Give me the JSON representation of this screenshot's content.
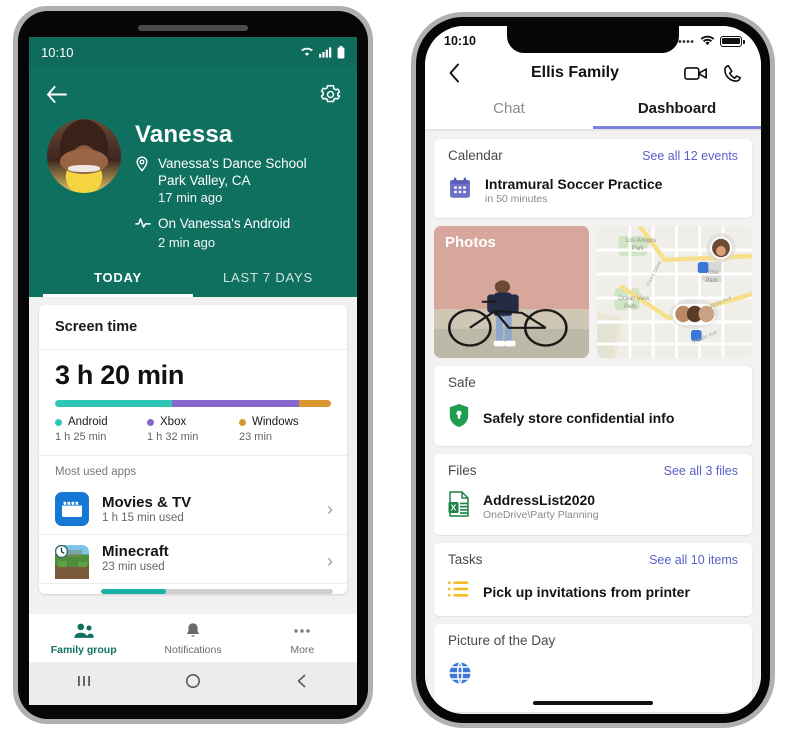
{
  "android": {
    "status": {
      "time": "10:10",
      "wifi_icon": "wifi-icon",
      "signal_icon": "cellular-signal-icon",
      "battery_icon": "battery-icon"
    },
    "header": {
      "back_icon": "back-arrow-icon",
      "settings_icon": "gear-icon",
      "profile_name": "Vanessa",
      "avatar": "avatar",
      "location_icon": "location-pin-icon",
      "location_line1": "Vanessa's Dance School",
      "location_line2": "Park Valley, CA",
      "location_time": "17 min ago",
      "activity_icon": "activity-pulse-icon",
      "activity_text": "On Vanessa's Android",
      "activity_time": "2 min ago",
      "tabs": [
        {
          "label": "TODAY",
          "active": true
        },
        {
          "label": "LAST 7 DAYS",
          "active": false
        }
      ]
    },
    "screen_time": {
      "card_title": "Screen time",
      "total": "3 h 20 min",
      "most_used_label": "Most used apps",
      "apps": [
        {
          "name": "Movies & TV",
          "usage": "1 h 15 min used",
          "icon": "movies-and-tv-icon",
          "chevron": "chevron-right-icon"
        },
        {
          "name": "Minecraft",
          "usage": "23 min used",
          "icon": "minecraft-icon",
          "chevron": "chevron-right-icon",
          "progress_pct": 28
        }
      ]
    },
    "bottom_nav": [
      {
        "label": "Family group",
        "icon": "family-group-icon",
        "active": true
      },
      {
        "label": "Notifications",
        "icon": "bell-icon",
        "active": false
      },
      {
        "label": "More",
        "icon": "more-dots-icon",
        "active": false
      }
    ],
    "system_nav": [
      {
        "icon": "recents-icon",
        "glyph": "|||"
      },
      {
        "icon": "home-icon",
        "glyph": "○"
      },
      {
        "icon": "back-icon",
        "glyph": "‹"
      }
    ]
  },
  "chart_data": {
    "type": "bar",
    "title": "Screen time",
    "orientation": "horizontal-stacked",
    "total_label": "3 h 20 min",
    "total_minutes": 200,
    "categories": [
      "Android",
      "Xbox",
      "Windows"
    ],
    "values": [
      85,
      92,
      23
    ],
    "value_labels": [
      "1 h 25 min",
      "1 h 32 min",
      "23 min"
    ],
    "colors": [
      "#2ec6b6",
      "#8766cd",
      "#d9982f"
    ],
    "percentages": [
      42.5,
      46.0,
      11.5
    ],
    "ylabel": "",
    "xlabel": "",
    "legend": "bottom",
    "grid": false
  },
  "ios": {
    "status": {
      "time": "10:10",
      "dots_icon": "signal-dots-icon",
      "wifi_icon": "wifi-icon",
      "battery_icon": "battery-icon"
    },
    "titlebar": {
      "back_icon": "chevron-left-icon",
      "title": "Ellis Family",
      "video_icon": "video-camera-icon",
      "call_icon": "phone-icon"
    },
    "tabs": [
      {
        "label": "Chat",
        "active": false
      },
      {
        "label": "Dashboard",
        "active": true
      }
    ],
    "cards": {
      "calendar": {
        "title": "Calendar",
        "link": "See all 12 events",
        "icon": "calendar-icon",
        "item_title": "Intramural Soccer Practice",
        "item_sub": "in 50 minutes"
      },
      "photos": {
        "label": "Photos",
        "icon": "photo-tile"
      },
      "map": {
        "icon": "map-tile",
        "labels": [
          "Los Amigos Park",
          "Ocean View Park",
          "Rose Park",
          "Front Stree",
          "Rose Ave",
          "Pacific Ave"
        ]
      },
      "safe": {
        "title": "Safe",
        "icon": "shield-lock-icon",
        "item_title": "Safely store confidential info"
      },
      "files": {
        "title": "Files",
        "link": "See all 3 files",
        "icon": "excel-file-icon",
        "item_title": "AddressList2020",
        "item_sub": "OneDrive\\Party Planning"
      },
      "tasks": {
        "title": "Tasks",
        "link": "See all 10 items",
        "icon": "task-list-icon",
        "item_title": "Pick up invitations from printer"
      },
      "picture_of_day": {
        "title": "Picture of the Day",
        "icon": "globe-icon"
      }
    },
    "home_indicator": "home-indicator"
  },
  "colors": {
    "android_teal": "#0f7060",
    "android_status_teal": "#0f6b5c",
    "teal_accent": "#17b2a4",
    "purple": "#8766cd",
    "orange": "#d9982f",
    "ios_link_purple": "#5b5fc7",
    "calendar_purple": "#6b6fc6",
    "safe_green": "#1f9e50",
    "excel_green": "#1d8348",
    "task_yellow": "#f5b924"
  }
}
